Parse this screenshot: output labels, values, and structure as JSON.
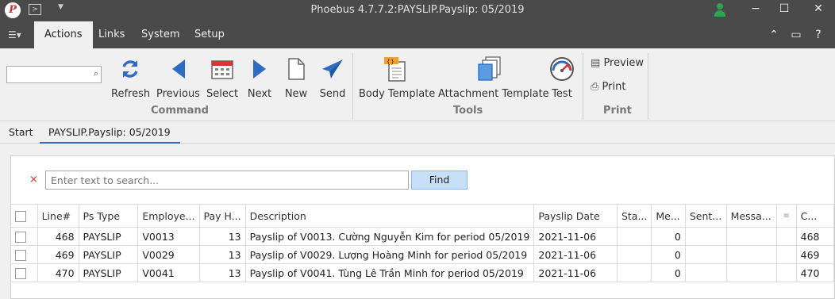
{
  "window": {
    "title": "Phoebus 4.7.7.2:PAYSLIP.Payslip: 05/2019",
    "logo": "P"
  },
  "menubar": {
    "tabs": [
      "Actions",
      "Links",
      "System",
      "Setup"
    ]
  },
  "ribbon": {
    "command": {
      "label": "Command",
      "buttons": [
        "Refresh",
        "Previous",
        "Select",
        "Next",
        "New",
        "Send"
      ]
    },
    "tools": {
      "label": "Tools",
      "buttons": [
        "Body Template",
        "Attachment Template",
        "Test"
      ]
    },
    "print": {
      "label": "Print",
      "buttons": [
        "Preview",
        "Print"
      ]
    }
  },
  "doctabs": [
    "Start",
    "PAYSLIP.Payslip: 05/2019"
  ],
  "search": {
    "placeholder": "Enter text to search...",
    "find_label": "Find",
    "clear": "×"
  },
  "grid": {
    "columns": [
      "Line#",
      "Ps Type",
      "Employe...",
      "Pay H...",
      "Description",
      "Payslip Date",
      "Sta...",
      "Me...",
      "Sent...",
      "Messa...",
      "",
      "C..."
    ],
    "rows": [
      [
        "468",
        "PAYSLIP",
        "V0013",
        "13",
        "Payslip of V0013. Cường Nguyễn Kim for period 05/2019",
        "2021-11-06",
        "",
        "0",
        "",
        "",
        "",
        "468"
      ],
      [
        "469",
        "PAYSLIP",
        "V0029",
        "13",
        "Payslip of V0029. Lượng Hoàng Minh for period 05/2019",
        "2021-11-06",
        "",
        "0",
        "",
        "",
        "",
        "469"
      ],
      [
        "470",
        "PAYSLIP",
        "V0041",
        "13",
        "Payslip of V0041. Tùng Lê Trần Minh for period 05/2019",
        "2021-11-06",
        "",
        "0",
        "",
        "",
        "",
        "470"
      ]
    ]
  },
  "colors": {
    "titlebar": "#4a4a4a",
    "accent": "#2b6cc4",
    "find_button": "#c7dff7",
    "user_status": "#2ea44f"
  }
}
